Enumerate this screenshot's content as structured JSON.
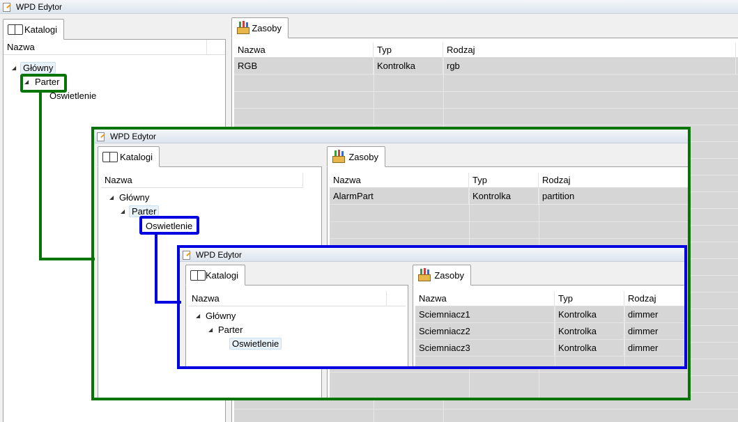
{
  "window": {
    "title": "WPD Edytor",
    "catalog_tab": "Katalogi",
    "resources_tab": "Zasoby",
    "tree_header": "Nazwa",
    "columns": [
      "Nazwa",
      "Typ",
      "Rodzaj"
    ]
  },
  "colors": {
    "green_highlight": "#067506",
    "blue_highlight": "#0000e0",
    "selection": "#e7f2fb"
  },
  "level1": {
    "tree": [
      "Główny",
      "Parter",
      "Oswietlenie"
    ],
    "rows": [
      {
        "name": "RGB",
        "type": "Kontrolka",
        "kind": "rgb"
      }
    ]
  },
  "level2": {
    "tree": [
      "Główny",
      "Parter",
      "Oswietlenie"
    ],
    "rows": [
      {
        "name": "AlarmPart",
        "type": "Kontrolka",
        "kind": "partition"
      }
    ]
  },
  "level3": {
    "tree": [
      "Główny",
      "Parter",
      "Oswietlenie"
    ],
    "rows": [
      {
        "name": "Sciemniacz1",
        "type": "Kontrolka",
        "kind": "dimmer"
      },
      {
        "name": "Sciemniacz2",
        "type": "Kontrolka",
        "kind": "dimmer"
      },
      {
        "name": "Sciemniacz3",
        "type": "Kontrolka",
        "kind": "dimmer"
      }
    ]
  }
}
